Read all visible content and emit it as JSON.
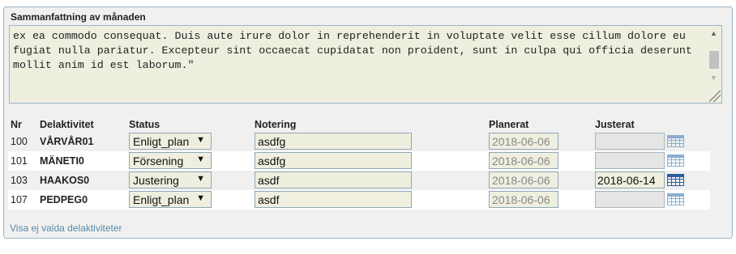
{
  "summary": {
    "label": "Sammanfattning av månaden",
    "text": "ex ea commodo consequat. Duis aute irure dolor in reprehenderit in voluptate velit esse cillum dolore eu fugiat nulla pariatur. Excepteur sint occaecat cupidatat non proident, sunt in culpa qui officia deserunt mollit anim id est laborum.\""
  },
  "table": {
    "headers": {
      "nr": "Nr",
      "activity": "Delaktivitet",
      "status": "Status",
      "note": "Notering",
      "planned": "Planerat",
      "adjusted": "Justerat"
    },
    "rows": [
      {
        "nr": "100",
        "code": "VÅRVÅR01",
        "status": "Enligt_plan",
        "note": "asdfg",
        "planned": "2018-06-06",
        "adjusted": ""
      },
      {
        "nr": "101",
        "code": "MÄNETI0",
        "status": "Försening",
        "note": "asdfg",
        "planned": "2018-06-06",
        "adjusted": ""
      },
      {
        "nr": "103",
        "code": "HAAKOS0",
        "status": "Justering",
        "note": "asdf",
        "planned": "2018-06-06",
        "adjusted": "2018-06-14"
      },
      {
        "nr": "107",
        "code": "PEDPEG0",
        "status": "Enligt_plan",
        "note": "asdf",
        "planned": "2018-06-06",
        "adjusted": ""
      }
    ]
  },
  "icons": {
    "dropdown_arrow": "▼",
    "scroll_up": "▲",
    "scroll_down": "▼"
  },
  "footer": {
    "show_unselected_link": "Visa ej valda delaktiviteter"
  }
}
